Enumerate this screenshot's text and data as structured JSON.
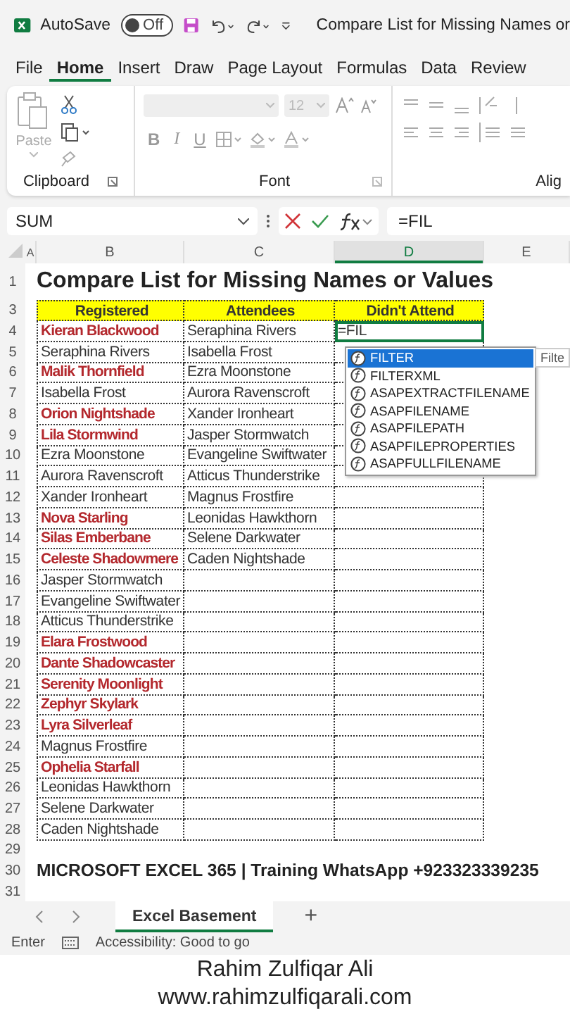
{
  "title_bar": {
    "autosave_label": "AutoSave",
    "autosave_on": false,
    "autosave_state": "Off",
    "title": "Compare List for Missing Names or"
  },
  "ribbon_tabs": [
    {
      "label": "File",
      "selected": false
    },
    {
      "label": "Home",
      "selected": true
    },
    {
      "label": "Insert",
      "selected": false
    },
    {
      "label": "Draw",
      "selected": false
    },
    {
      "label": "Page Layout",
      "selected": false
    },
    {
      "label": "Formulas",
      "selected": false
    },
    {
      "label": "Data",
      "selected": false
    },
    {
      "label": "Review",
      "selected": false
    }
  ],
  "ribbon": {
    "clipboard": {
      "paste_label": "Paste",
      "group_label": "Clipboard"
    },
    "font": {
      "size": "12",
      "styles": [
        "B",
        "I",
        "U"
      ],
      "group_label": "Font"
    },
    "alignment": {
      "group_label": "Alig"
    }
  },
  "formula_bar": {
    "name_box": "SUM",
    "formula": "=FIL"
  },
  "columns": [
    {
      "label": "A",
      "selected": false
    },
    {
      "label": "B",
      "selected": false
    },
    {
      "label": "C",
      "selected": false
    },
    {
      "label": "D",
      "selected": true
    },
    {
      "label": "E",
      "selected": false
    }
  ],
  "sheet": {
    "title_row": "1",
    "title": "Compare List for Missing Names or Values",
    "header_row": "3",
    "headers": [
      "Registered",
      "Attendees",
      "Didn't Attend"
    ],
    "rows": [
      {
        "num": "4",
        "registered": "Kieran Blackwood",
        "missing": true,
        "attendee": "Seraphina Rivers",
        "result": "=FIL",
        "active": true
      },
      {
        "num": "5",
        "registered": "Seraphina Rivers",
        "missing": false,
        "attendee": "Isabella Frost",
        "active": false
      },
      {
        "num": "6",
        "registered": "Malik Thornfield",
        "missing": true,
        "attendee": "Ezra Moonstone",
        "active": false
      },
      {
        "num": "7",
        "registered": "Isabella Frost",
        "missing": false,
        "attendee": "Aurora Ravenscroft",
        "active": false
      },
      {
        "num": "8",
        "registered": "Orion Nightshade",
        "missing": true,
        "attendee": "Xander Ironheart",
        "active": false
      },
      {
        "num": "9",
        "registered": "Lila Stormwind",
        "missing": true,
        "attendee": "Jasper Stormwatch",
        "active": false
      },
      {
        "num": "10",
        "registered": "Ezra Moonstone",
        "missing": false,
        "attendee": "Evangeline Swiftwater",
        "active": false
      },
      {
        "num": "11",
        "registered": "Aurora Ravenscroft",
        "missing": false,
        "attendee": "Atticus Thunderstrike",
        "active": false
      },
      {
        "num": "12",
        "registered": "Xander Ironheart",
        "missing": false,
        "attendee": "Magnus Frostfire",
        "active": false
      },
      {
        "num": "13",
        "registered": "Nova Starling",
        "missing": true,
        "attendee": "Leonidas Hawkthorn",
        "active": false
      },
      {
        "num": "14",
        "registered": "Silas Emberbane",
        "missing": true,
        "attendee": "Selene Darkwater",
        "active": false
      },
      {
        "num": "15",
        "registered": "Celeste Shadowmere",
        "missing": true,
        "attendee": "Caden Nightshade",
        "active": false
      },
      {
        "num": "16",
        "registered": "Jasper Stormwatch",
        "missing": false,
        "active": false
      },
      {
        "num": "17",
        "registered": "Evangeline Swiftwater",
        "missing": false,
        "active": false
      },
      {
        "num": "18",
        "registered": "Atticus Thunderstrike",
        "missing": false,
        "active": false
      },
      {
        "num": "19",
        "registered": "Elara Frostwood",
        "missing": true,
        "active": false
      },
      {
        "num": "20",
        "registered": "Dante Shadowcaster",
        "missing": true,
        "active": false
      },
      {
        "num": "21",
        "registered": "Serenity Moonlight",
        "missing": true,
        "active": false
      },
      {
        "num": "22",
        "registered": "Zephyr Skylark",
        "missing": true,
        "active": false
      },
      {
        "num": "23",
        "registered": "Lyra Silverleaf",
        "missing": true,
        "active": false
      },
      {
        "num": "24",
        "registered": "Magnus Frostfire",
        "missing": false,
        "active": false
      },
      {
        "num": "25",
        "registered": "Ophelia Starfall",
        "missing": true,
        "active": false
      },
      {
        "num": "26",
        "registered": "Leonidas Hawkthorn",
        "missing": false,
        "active": false
      },
      {
        "num": "27",
        "registered": "Selene Darkwater",
        "missing": false,
        "active": false
      },
      {
        "num": "28",
        "registered": "Caden Nightshade",
        "missing": false,
        "active": false
      }
    ],
    "footer_rows": [
      {
        "num": "29"
      },
      {
        "num": "30",
        "text": "MICROSOFT EXCEL 365 | Training WhatsApp +923323339235"
      },
      {
        "num": "31"
      }
    ]
  },
  "autocomplete": {
    "items": [
      {
        "label": "FILTER",
        "selected": true
      },
      {
        "label": "FILTERXML",
        "selected": false
      },
      {
        "label": "ASAPEXTRACTFILENAME",
        "selected": false
      },
      {
        "label": "ASAPFILENAME",
        "selected": false
      },
      {
        "label": "ASAPFILEPATH",
        "selected": false
      },
      {
        "label": "ASAPFILEPROPERTIES",
        "selected": false
      },
      {
        "label": "ASAPFULLFILENAME",
        "selected": false
      }
    ],
    "tooltip": "Filte"
  },
  "sheet_tabs": [
    {
      "label": "Excel Basement",
      "selected": true
    }
  ],
  "add_sheet": "+",
  "status_bar": {
    "mode": "Enter",
    "accessibility": "Accessibility: Good to go"
  },
  "caption": [
    "Rahim Zulfiqar Ali",
    "www.rahimzulfiqarali.com"
  ]
}
